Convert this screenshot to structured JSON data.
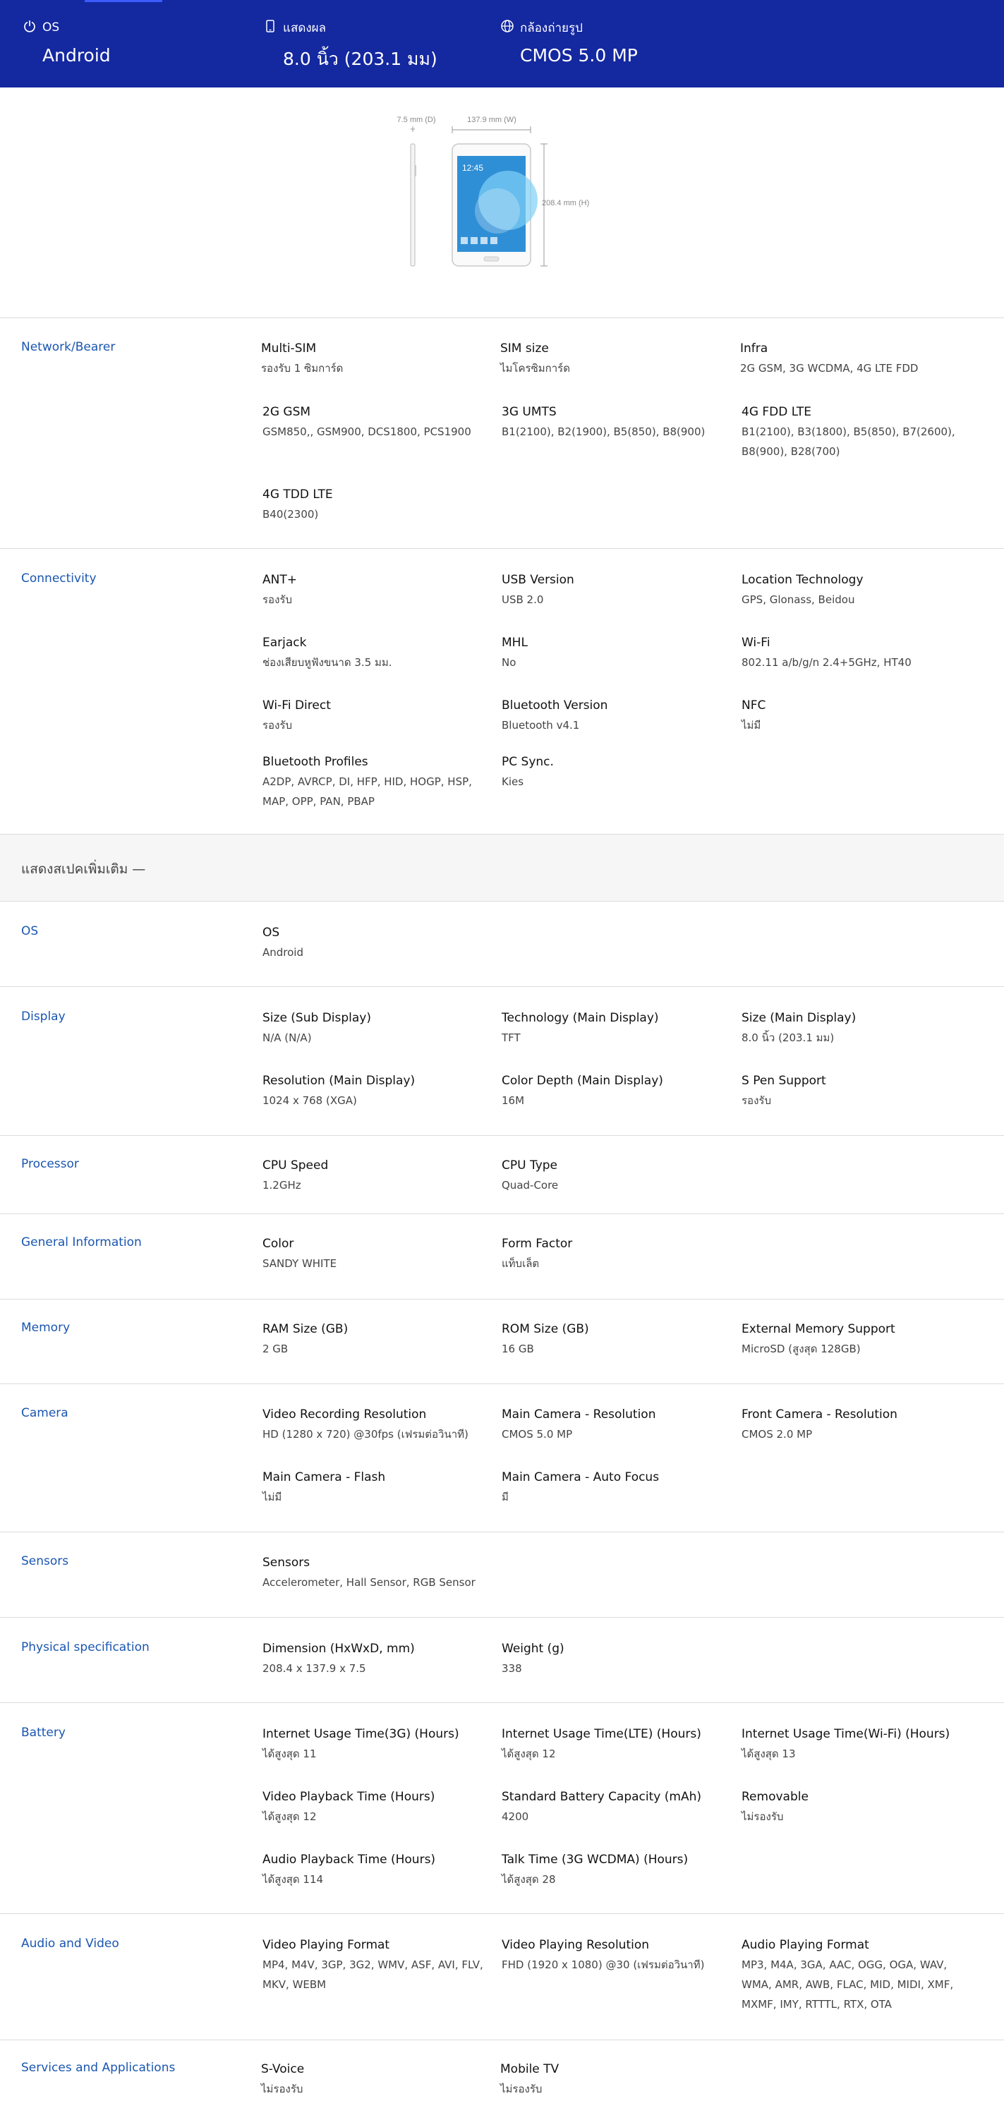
{
  "summary": {
    "os": {
      "label": "OS",
      "value": "Android",
      "icon": "power-icon"
    },
    "display": {
      "label": "แสดงผล",
      "value": "8.0 นิ้ว (203.1 มม)",
      "icon": "phone-icon"
    },
    "camera": {
      "label": "กล้องถ่ายรูป",
      "value": "CMOS 5.0 MP",
      "icon": "globe-icon"
    }
  },
  "device_image": {
    "depth_label": "7.5 mm (D)",
    "width_label": "137.9 mm (W)",
    "height_label": "208.4 mm (H)",
    "clock_text": "12:45"
  },
  "sections": [
    {
      "title": "Network/Bearer",
      "specs": [
        {
          "k": "Multi-SIM",
          "v": "รองรับ 1 ซิมการ์ด"
        },
        {
          "k": "SIM size",
          "v": "ไมโครซิมการ์ด"
        },
        {
          "k": "Infra",
          "v": "2G GSM, 3G WCDMA, 4G LTE FDD"
        },
        {
          "k": "2G GSM",
          "v": "GSM850,, GSM900, DCS1800, PCS1900"
        },
        {
          "k": "3G UMTS",
          "v": "B1(2100), B2(1900), B5(850), B8(900)"
        },
        {
          "k": "4G FDD LTE",
          "v": "B1(2100), B3(1800), B5(850), B7(2600), B8(900), B28(700)"
        },
        {
          "k": "4G TDD LTE",
          "v": "B40(2300)"
        }
      ]
    },
    {
      "title": "Connectivity",
      "specs": [
        {
          "k": "ANT+",
          "v": "รองรับ"
        },
        {
          "k": "USB Version",
          "v": "USB 2.0"
        },
        {
          "k": "Location Technology",
          "v": "GPS, Glonass, Beidou"
        },
        {
          "k": "Earjack",
          "v": "ช่องเสียบหูฟังขนาด 3.5 มม."
        },
        {
          "k": "MHL",
          "v": "No"
        },
        {
          "k": "Wi-Fi",
          "v": "802.11 a/b/g/n 2.4+5GHz, HT40"
        },
        {
          "k": "Wi-Fi Direct",
          "v": "รองรับ"
        },
        {
          "k": "Bluetooth Version",
          "v": "Bluetooth v4.1"
        },
        {
          "k": "NFC",
          "v": "ไม่มี"
        },
        {
          "k": "Bluetooth Profiles",
          "v": "A2DP, AVRCP, DI, HFP, HID, HOGP, HSP, MAP, OPP, PAN, PBAP"
        },
        {
          "k": "PC Sync.",
          "v": "Kies"
        }
      ]
    },
    {
      "title": "OS",
      "specs": [
        {
          "k": "OS",
          "v": "Android"
        }
      ]
    },
    {
      "title": "Display",
      "specs": [
        {
          "k": "Size (Sub Display)",
          "v": "N/A (N/A)"
        },
        {
          "k": "Technology (Main Display)",
          "v": "TFT"
        },
        {
          "k": "Size (Main Display)",
          "v": "8.0 นิ้ว (203.1 มม)"
        },
        {
          "k": "Resolution (Main Display)",
          "v": "1024 x 768 (XGA)"
        },
        {
          "k": "Color Depth (Main Display)",
          "v": "16M"
        },
        {
          "k": "S Pen Support",
          "v": "รองรับ"
        }
      ]
    },
    {
      "title": "Processor",
      "specs": [
        {
          "k": "CPU Speed",
          "v": "1.2GHz"
        },
        {
          "k": "CPU Type",
          "v": "Quad-Core"
        }
      ]
    },
    {
      "title": "General Information",
      "specs": [
        {
          "k": "Color",
          "v": "SANDY WHITE"
        },
        {
          "k": "Form Factor",
          "v": "แท็บเล็ต"
        }
      ]
    },
    {
      "title": "Memory",
      "specs": [
        {
          "k": "RAM Size (GB)",
          "v": "2 GB"
        },
        {
          "k": "ROM Size (GB)",
          "v": "16 GB"
        },
        {
          "k": "External Memory Support",
          "v": "MicroSD (สูงสุด 128GB)"
        }
      ]
    },
    {
      "title": "Camera",
      "specs": [
        {
          "k": "Video Recording Resolution",
          "v": "HD (1280 x 720) @30fps (เฟรมต่อวินาที)"
        },
        {
          "k": "Main Camera - Resolution",
          "v": "CMOS 5.0 MP"
        },
        {
          "k": "Front Camera - Resolution",
          "v": "CMOS 2.0 MP"
        },
        {
          "k": "Main Camera - Flash",
          "v": "ไม่มี"
        },
        {
          "k": "Main Camera - Auto Focus",
          "v": "มี"
        }
      ]
    },
    {
      "title": "Sensors",
      "specs": [
        {
          "k": "Sensors",
          "v": "Accelerometer, Hall Sensor, RGB Sensor"
        }
      ]
    },
    {
      "title": "Physical specification",
      "specs": [
        {
          "k": "Dimension (HxWxD, mm)",
          "v": "208.4 x 137.9 x 7.5"
        },
        {
          "k": "Weight (g)",
          "v": "338"
        }
      ]
    },
    {
      "title": "Battery",
      "specs": [
        {
          "k": "Internet Usage Time(3G) (Hours)",
          "v": "ได้สูงสุด 11"
        },
        {
          "k": "Internet Usage Time(LTE) (Hours)",
          "v": "ได้สูงสุด 12"
        },
        {
          "k": "Internet Usage Time(Wi-Fi) (Hours)",
          "v": "ได้สูงสุด 13"
        },
        {
          "k": "Video Playback Time (Hours)",
          "v": "ได้สูงสุด 12"
        },
        {
          "k": "Standard Battery Capacity (mAh)",
          "v": "4200"
        },
        {
          "k": "Removable",
          "v": "ไม่รองรับ"
        },
        {
          "k": "Audio Playback Time (Hours)",
          "v": "ได้สูงสุด 114"
        },
        {
          "k": "Talk Time (3G WCDMA) (Hours)",
          "v": "ได้สูงสุด 28"
        }
      ]
    },
    {
      "title": "Audio and Video",
      "specs": [
        {
          "k": "Video Playing Format",
          "v": "MP4, M4V, 3GP, 3G2, WMV, ASF, AVI, FLV, MKV, WEBM"
        },
        {
          "k": "Video Playing Resolution",
          "v": "FHD (1920 x 1080) @30 (เฟรมต่อวินาที)"
        },
        {
          "k": "Audio Playing Format",
          "v": "MP3, M4A, 3GA, AAC, OGG, OGA, WAV, WMA, AMR, AWB, FLAC, MID, MIDI, XMF, MXMF, IMY, RTTTL, RTX, OTA"
        }
      ]
    },
    {
      "title": "Services and Applications",
      "specs": [
        {
          "k": "S-Voice",
          "v": "ไม่รองรับ"
        },
        {
          "k": "Mobile TV",
          "v": "ไม่รองรับ"
        }
      ]
    }
  ],
  "more_specs_label": "แสดงสเปคเพิ่มเติม —"
}
